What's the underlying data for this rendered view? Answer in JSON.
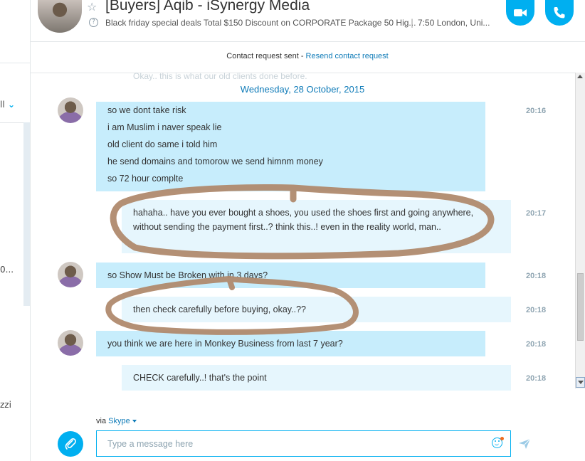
{
  "sidebar": {
    "filter_label": "ll",
    "truncated_item": "0...",
    "truncated_name": "zzi"
  },
  "header": {
    "title": "[Buyers] Aqib - iSynergy Media",
    "mood": "Black friday special deals Total $150 Discount on CORPORATE Package 50 Hig...",
    "separator": "|",
    "location": "7:50 London, Uni..."
  },
  "contact_request": {
    "status": "Contact request sent - ",
    "resend_link": "Resend contact request"
  },
  "faded_message": "Okay.. this is what our old clients done before.",
  "date_separator": "Wednesday, 28 October, 2015",
  "messages": [
    {
      "lines": [
        "so we dont take risk",
        "i am Muslim i naver speak lie",
        "old client do same i told him",
        "he send domains and tomorow we send himnm money",
        "so 72 hour complte"
      ],
      "time": "20:16"
    },
    {
      "text": "hahaha.. have you ever bought a shoes, you used the shoes first and going anywhere, without sending the payment first..? think this..! even in the reality world, man..",
      "time": "20:17"
    },
    {
      "text": "so Show Must be Broken with in 3 days?",
      "time": "20:18"
    },
    {
      "text": "then check carefully before buying, okay..??",
      "time": "20:18"
    },
    {
      "text": "you think we are here in Monkey Business from last 7 year?",
      "time": "20:18"
    },
    {
      "text": "CHECK carefully..! that's the point",
      "time": "20:18"
    }
  ],
  "composer": {
    "via_label": "via ",
    "via_service": "Skype",
    "placeholder": "Type a message here"
  },
  "colors": {
    "accent": "#00aff0",
    "incoming_bubble": "#c7edfc",
    "outgoing_bubble": "#e6f6fd",
    "link": "#0f7bb8",
    "annotation": "#b08a6e"
  }
}
